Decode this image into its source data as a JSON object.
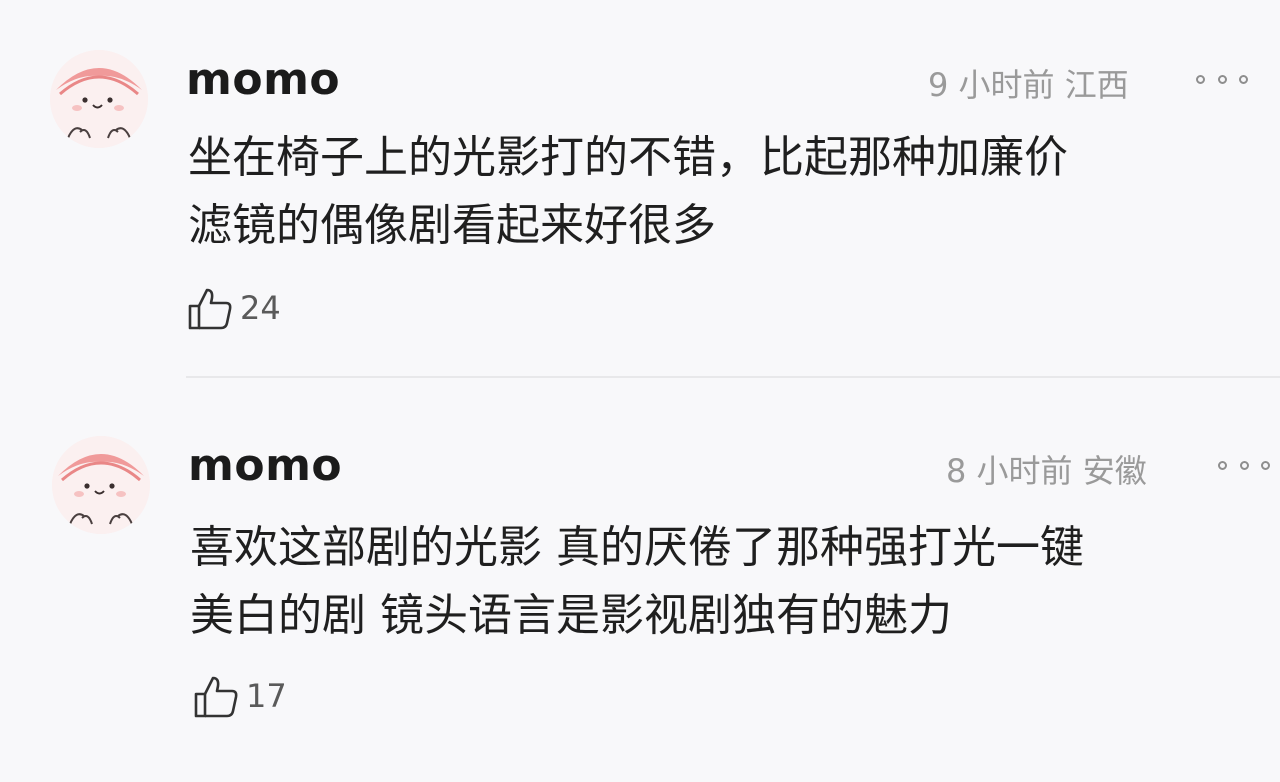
{
  "comments": [
    {
      "username": "momo",
      "meta": "9 小时前 江西",
      "lines": [
        "坐在椅子上的光影打的不错，比起那种加廉价",
        "滤镜的偶像剧看起来好很多"
      ],
      "likes": "24",
      "icons": {
        "more": "more-dots-icon",
        "like": "thumbs-up-icon"
      }
    },
    {
      "username": "momo",
      "meta": "8 小时前 安徽",
      "lines": [
        "喜欢这部剧的光影 真的厌倦了那种强打光一键",
        "美白的剧 镜头语言是影视剧独有的魅力"
      ],
      "likes": "17",
      "icons": {
        "more": "more-dots-icon",
        "like": "thumbs-up-icon"
      }
    }
  ]
}
